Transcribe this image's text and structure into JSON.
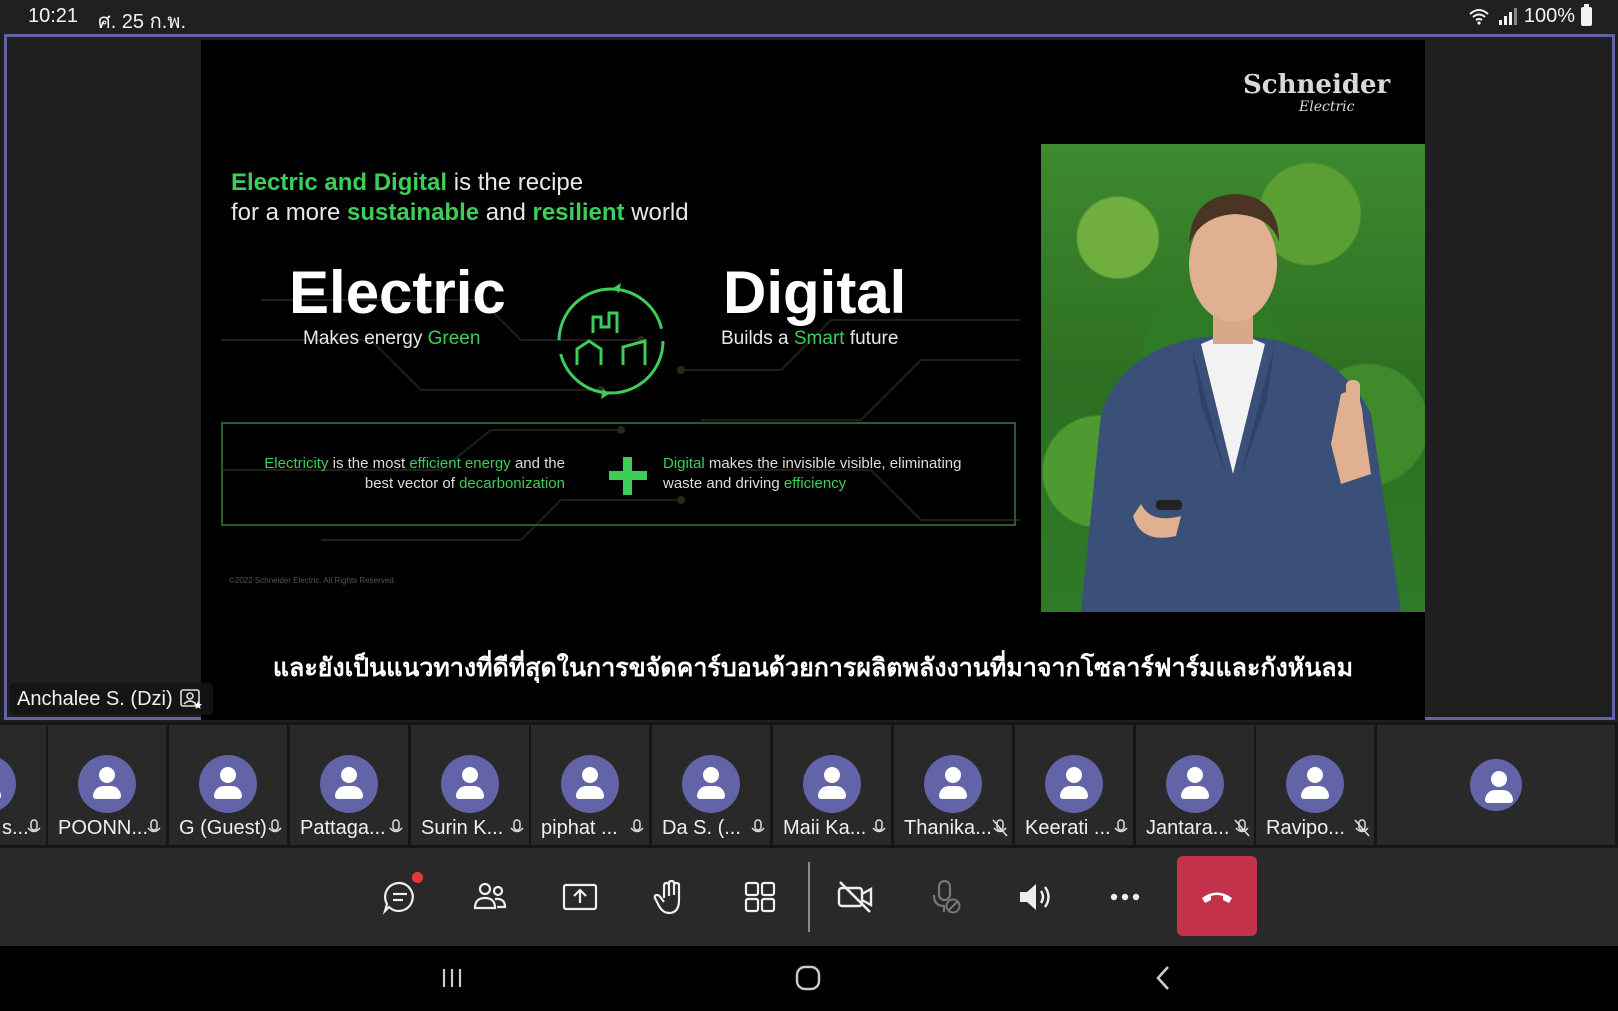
{
  "status_bar": {
    "time": "10:21",
    "date": "ศ. 25 ก.พ.",
    "battery": "100%"
  },
  "presentation": {
    "logo_main": "Schneider",
    "logo_sub": "Electric",
    "heading_line1_green": "Electric and Digital",
    "heading_line1_rest": " is the recipe",
    "heading_line2_a": "for a more ",
    "heading_line2_green1": "sustainable",
    "heading_line2_b": " and ",
    "heading_line2_green2": "resilient",
    "heading_line2_c": " world",
    "left_title": "Electric",
    "left_sub_a": "Makes energy ",
    "left_sub_green": "Green",
    "right_title": "Digital",
    "right_sub_a": "Builds a ",
    "right_sub_green": "Smart",
    "right_sub_b": " future",
    "box_left_g1": "Electricity",
    "box_left_a": " is the most ",
    "box_left_g2": "efficient energy",
    "box_left_b": " and the best vector of ",
    "box_left_g3": "decarbonization",
    "box_right_g1": "Digital",
    "box_right_a": " makes the invisible visible, eliminating waste and driving ",
    "box_right_g2": "efficiency",
    "copyright": "©2022 Schneider Electric. All Rights Reserved.",
    "subtitle": "และยังเป็นแนวทางที่ดีที่สุดในการขจัดคาร์บอนด้วยการผลิตพลังงานที่มาจากโซลาร์ฟาร์มและกังหันลม"
  },
  "presenter": {
    "name": "Anchalee S. (Dzi)",
    "icon": "presenter-icon"
  },
  "participants": [
    {
      "name": "s...",
      "mic": "mic-icon"
    },
    {
      "name": "POONN...",
      "mic": "mic-icon"
    },
    {
      "name": "G (Guest)",
      "mic": "mic-icon"
    },
    {
      "name": "Pattaga...",
      "mic": "mic-icon"
    },
    {
      "name": "Surin K...",
      "mic": "mic-icon"
    },
    {
      "name": "piphat ...",
      "mic": "mic-icon"
    },
    {
      "name": "Da S. (...",
      "mic": "mic-icon"
    },
    {
      "name": "Maii Ka...",
      "mic": "mic-icon"
    },
    {
      "name": "Thanika...",
      "mic": "mic-off-icon"
    },
    {
      "name": "Keerati ...",
      "mic": "mic-icon"
    },
    {
      "name": "Jantara...",
      "mic": "mic-off-icon"
    },
    {
      "name": "Ravipo...",
      "mic": "mic-off-icon"
    },
    {
      "name": "",
      "mic": ""
    }
  ],
  "controls": {
    "chat": "chat-icon",
    "people": "people-icon",
    "share": "share-screen-icon",
    "raise_hand": "raise-hand-icon",
    "view": "grid-view-icon",
    "camera": "camera-off-icon",
    "mic": "mic-disabled-icon",
    "speaker": "speaker-icon",
    "more": "more-icon",
    "hangup": "hang-up-icon"
  },
  "colors": {
    "accent": "#6264a7",
    "green": "#3dcd58",
    "hangup": "#c4314b",
    "notification": "#e8373b"
  }
}
